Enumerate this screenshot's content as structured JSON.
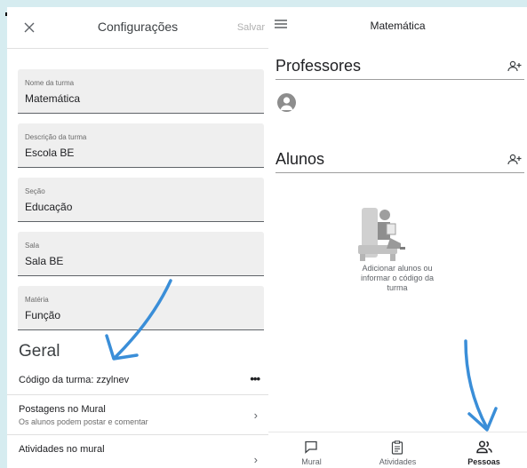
{
  "settings": {
    "title": "Configurações",
    "save_label": "Salvar",
    "fields": [
      {
        "label": "Nome da turma",
        "value": "Matemática"
      },
      {
        "label": "Descrição da turma",
        "value": "Escola BE"
      },
      {
        "label": "Seção",
        "value": "Educação"
      },
      {
        "label": "Sala",
        "value": "Sala BE"
      },
      {
        "label": "Matéria",
        "value": "Função"
      }
    ],
    "section_title": "Geral",
    "class_code": "Código da turma: zzylnev",
    "more_label": "•••",
    "posts_title": "Postagens no Mural",
    "posts_subtitle": "Os alunos podem postar e comentar",
    "activities_title": "Atividades no mural",
    "chevron": "›"
  },
  "people": {
    "title": "Matemática",
    "teachers_title": "Professores",
    "students_title": "Alunos",
    "empty_text_1": "Adicionar alunos ou",
    "empty_text_2": "informar o código da",
    "empty_text_3": "turma"
  },
  "nav": {
    "items": [
      {
        "label": "Mural",
        "icon": "chat-icon"
      },
      {
        "label": "Atividades",
        "icon": "clipboard-icon"
      },
      {
        "label": "Pessoas",
        "icon": "people-icon",
        "active": true
      }
    ]
  },
  "colors": {
    "background": "#d6ecf0",
    "annotation_arrow": "#3a8ed8"
  }
}
